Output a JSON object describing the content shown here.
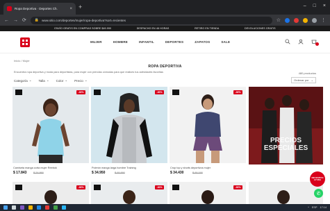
{
  "browser": {
    "tab_title": "Ropa Deportiva · Deportes Ch.",
    "tab_close": "×",
    "new_tab": "+",
    "url": "www.sitio.com/deportes/mujer/ropa-deportiva?sort=recientes",
    "window_controls": [
      "–",
      "□",
      "×"
    ]
  },
  "promo_bar": [
    "ENVÍO GRATIS EN COMPRAS SOBRE $49.990",
    "DESPACHO EN 48 HORAS",
    "RETIRO EN TIENDA",
    "DEVOLUCIONES GRATIS"
  ],
  "header": {
    "nav": [
      "MUJER",
      "HOMBRE",
      "INFANTIL",
      "DEPORTES",
      "ZAPATOS",
      "SALE"
    ]
  },
  "breadcrumb": "Inicio / Mujer",
  "page": {
    "title": "ROPA DEPORTIVA",
    "description": "Encuentra ropa deportiva y moda para deportistas, para mujer con prendas cómodas para que realices tus actividades favoritas",
    "results": "480 productos"
  },
  "filters": [
    "Categoría",
    "Talla",
    "Color",
    "Precio"
  ],
  "sort": {
    "label": "Ordenar por"
  },
  "products": [
    {
      "name": "Camiseta manga corta mujer Reebok",
      "price": "$ 17.843",
      "old_price": "$ 24.990",
      "discount": "-30%"
    },
    {
      "name": "Polerón manga larga hombre Training",
      "price": "$ 34.950",
      "old_price": "$ 49.990",
      "discount": "-30%"
    },
    {
      "name": "Crop top y shorts deportivos mujer",
      "price": "$ 34.430",
      "old_price": "$ 49.190",
      "discount": "-30%"
    }
  ],
  "promo_card": {
    "line1": "PRECIOS",
    "line2": "ESPECIALES"
  },
  "second_row_discounts": [
    "-30%",
    "-30%",
    "-30%"
  ],
  "chat_badge": "NECESITAS AYUDA",
  "taskbar": {
    "time": "17:14",
    "lang": "ESP"
  },
  "colors": {
    "brand_red": "#d9001b",
    "dark": "#1a1a1a",
    "whatsapp": "#25d366"
  }
}
